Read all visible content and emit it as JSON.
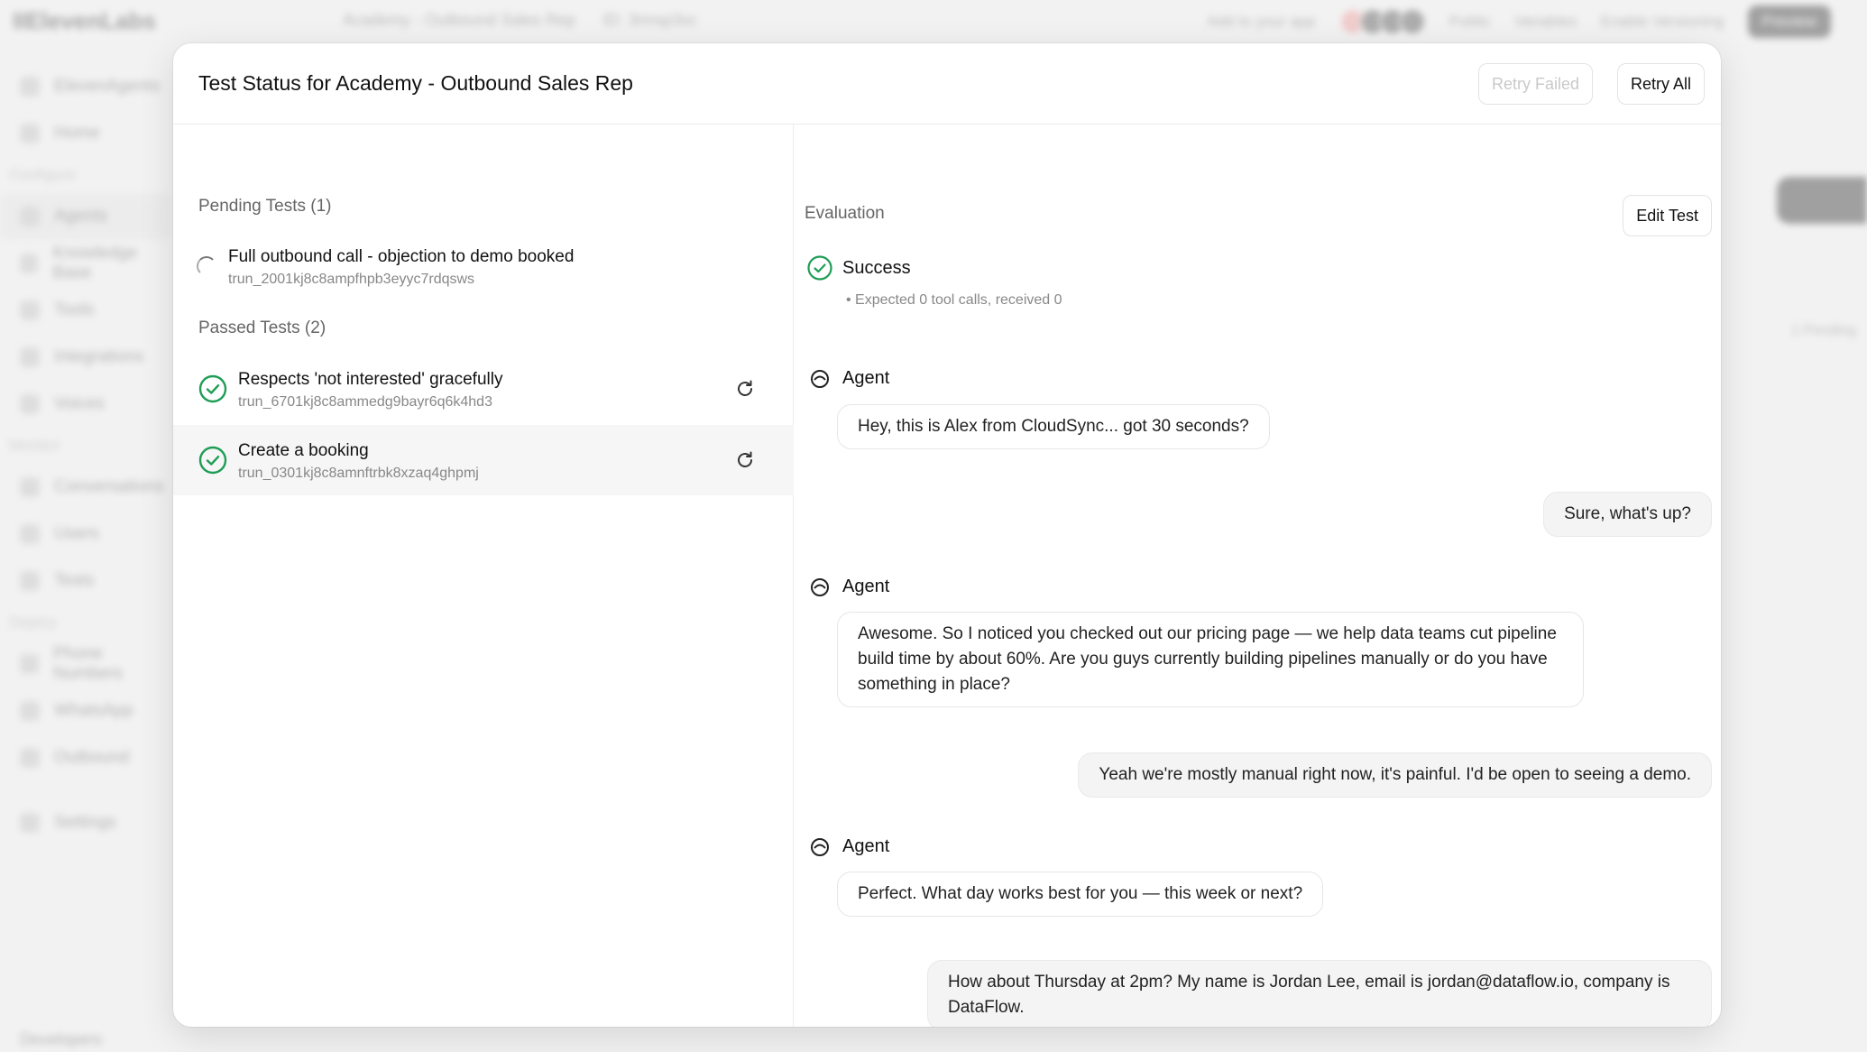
{
  "background": {
    "logo": "IIElevenLabs",
    "breadcrumbs": [
      "Academy - Outbound Sales Rep",
      "ID: 3nnsp3xc"
    ],
    "top_right": [
      "Add to your app",
      "Public",
      "Variables",
      "Enable Versioning",
      "Preview"
    ],
    "sidebar": [
      {
        "type": "item",
        "label": "ElevenAgents"
      },
      {
        "type": "item",
        "label": "Home"
      },
      {
        "type": "section",
        "label": "Configure"
      },
      {
        "type": "item",
        "label": "Agents",
        "active": true
      },
      {
        "type": "item",
        "label": "Knowledge Base"
      },
      {
        "type": "item",
        "label": "Tools"
      },
      {
        "type": "item",
        "label": "Integrations"
      },
      {
        "type": "item",
        "label": "Voices"
      },
      {
        "type": "section",
        "label": "Monitor"
      },
      {
        "type": "item",
        "label": "Conversations"
      },
      {
        "type": "item",
        "label": "Users"
      },
      {
        "type": "item",
        "label": "Tests"
      },
      {
        "type": "section",
        "label": "Deploy"
      },
      {
        "type": "item",
        "label": "Phone Numbers"
      },
      {
        "type": "item",
        "label": "WhatsApp"
      },
      {
        "type": "item",
        "label": "Outbound"
      },
      {
        "type": "item",
        "label": "Settings"
      }
    ],
    "pending_badge": "1 Pending",
    "developers": "Developers"
  },
  "modal": {
    "title": "Test Status for Academy - Outbound Sales Rep",
    "retry_failed_label": "Retry Failed",
    "retry_all_label": "Retry All"
  },
  "pending": {
    "title": "Pending Tests (1)",
    "tests": [
      {
        "name": "Full outbound call - objection to demo booked",
        "id": "trun_2001kj8c8ampfhpb3eyyc7rdqsws"
      }
    ]
  },
  "passed": {
    "title": "Passed Tests (2)",
    "tests": [
      {
        "name": "Respects 'not interested' gracefully",
        "id": "trun_6701kj8c8ammedg9bayr6q6k4hd3"
      },
      {
        "name": "Create a booking",
        "id": "trun_0301kj8c8amnftrbk8xzaq4ghpmj"
      }
    ]
  },
  "evaluation": {
    "label": "Evaluation",
    "edit_label": "Edit Test",
    "result": "Success",
    "detail": "• Expected 0 tool calls, received 0"
  },
  "transcript": [
    {
      "role": "agent",
      "speaker": "Agent",
      "text": "Hey, this is Alex from CloudSync... got 30 seconds?"
    },
    {
      "role": "user",
      "text": "Sure, what's up?"
    },
    {
      "role": "agent",
      "speaker": "Agent",
      "text": "Awesome. So I noticed you checked out our pricing page — we help data teams cut pipeline build time by about 60%. Are you guys currently building pipelines manually or do you have something in place?"
    },
    {
      "role": "user",
      "text": "Yeah we're mostly manual right now, it's painful. I'd be open to seeing a demo."
    },
    {
      "role": "agent",
      "speaker": "Agent",
      "text": "Perfect. What day works best for you — this week or next?"
    },
    {
      "role": "user",
      "text": "How about Thursday at 2pm? My name is Jordan Lee, email is jordan@dataflow.io, company is DataFlow."
    }
  ],
  "colors": {
    "success": "#1f9d55",
    "primary_text": "#111111",
    "muted_text": "#888888"
  }
}
